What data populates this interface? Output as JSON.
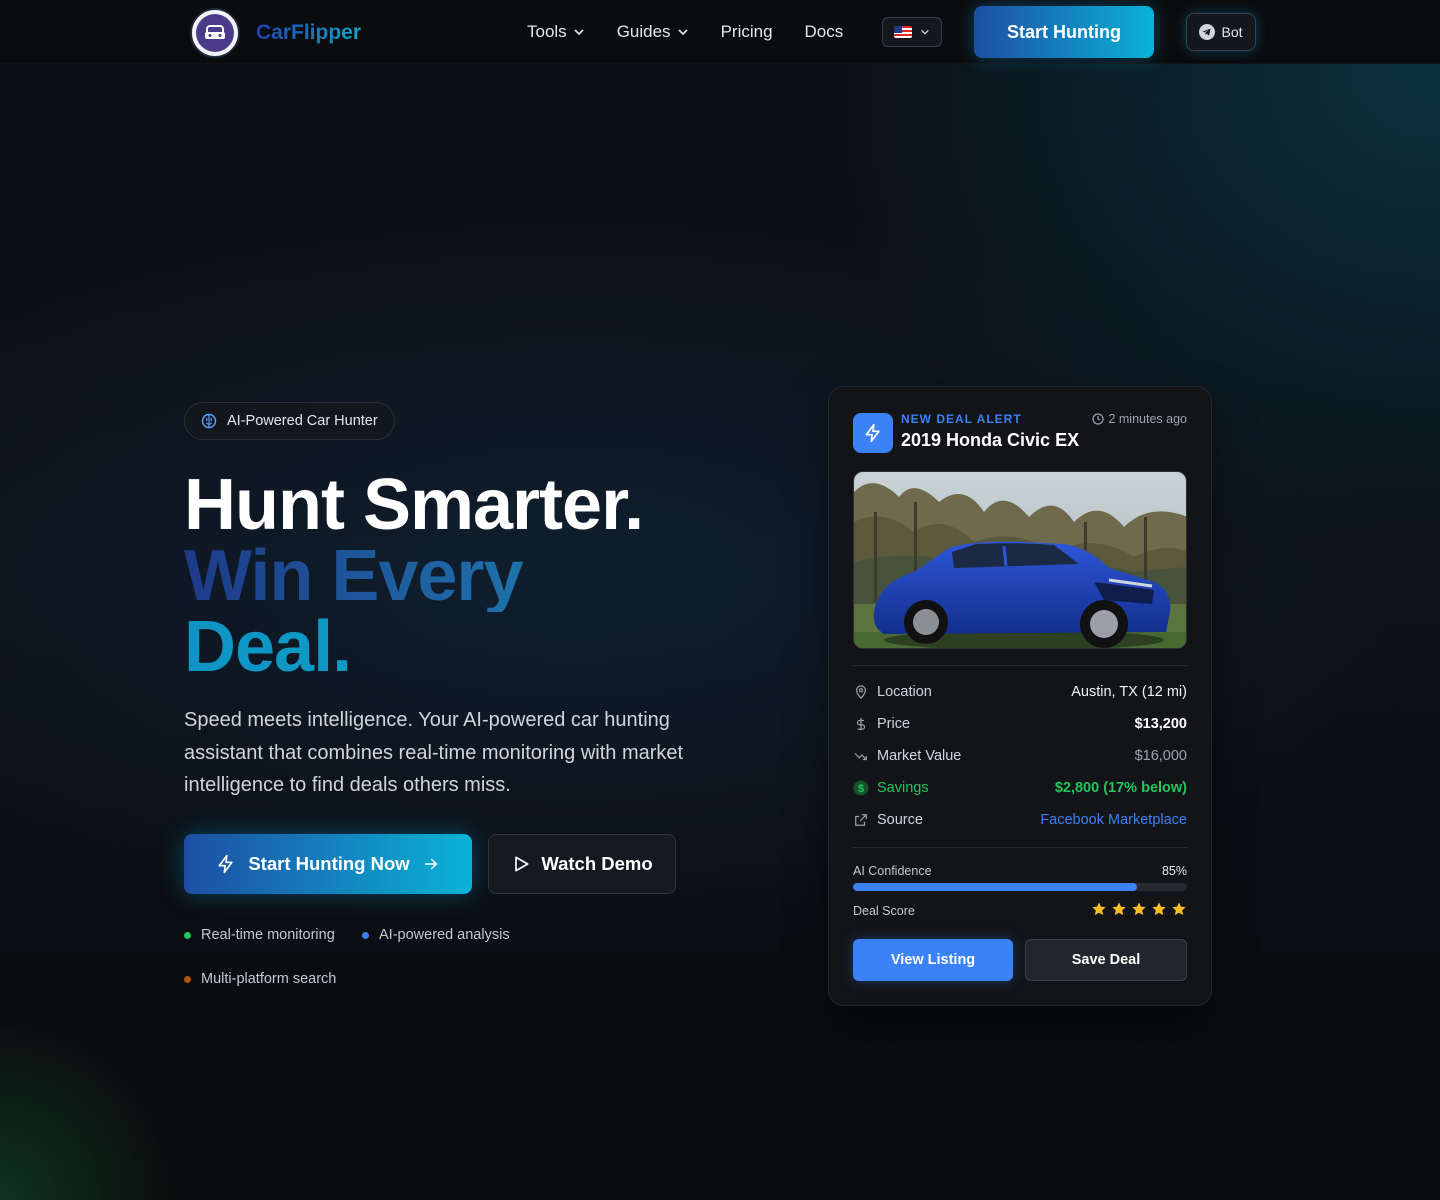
{
  "brand": {
    "name": "CarFlipper"
  },
  "nav": {
    "items": [
      {
        "label": "Tools",
        "has_dropdown": true
      },
      {
        "label": "Guides",
        "has_dropdown": true
      },
      {
        "label": "Pricing",
        "has_dropdown": false
      },
      {
        "label": "Docs",
        "has_dropdown": false
      }
    ],
    "language_flag": "us-flag-icon",
    "start_label": "Start Hunting",
    "bot_label": "Bot"
  },
  "hero": {
    "badge": "AI-Powered Car Hunter",
    "headline_line1": "Hunt Smarter.",
    "headline_line2": "Win Every",
    "headline_line3": "Deal.",
    "subtitle": "Speed meets intelligence. Your AI-powered car hunting assistant that combines real-time monitoring with market intelligence to find deals others miss.",
    "cta_primary": "Start Hunting Now",
    "cta_secondary": "Watch Demo",
    "features": [
      {
        "label": "Real-time monitoring",
        "color": "#22c55e"
      },
      {
        "label": "AI-powered analysis",
        "color": "#3b82f6"
      },
      {
        "label": "Multi-platform search",
        "color": "#b45309"
      }
    ]
  },
  "deal_card": {
    "alert_label": "NEW DEAL ALERT",
    "time_ago": "2 minutes ago",
    "title": "2019 Honda Civic EX",
    "rows": [
      {
        "icon": "map-pin-icon",
        "label": "Location",
        "value": "Austin, TX (12 mi)"
      },
      {
        "icon": "dollar-icon",
        "label": "Price",
        "value": "$13,200"
      },
      {
        "icon": "trending-down-icon",
        "label": "Market Value",
        "value": "$16,000"
      },
      {
        "icon": "savings-icon",
        "label": "Savings",
        "value": "$2,800 (17% below)"
      },
      {
        "icon": "external-link-icon",
        "label": "Source",
        "value": "Facebook Marketplace"
      }
    ],
    "confidence_label": "AI Confidence",
    "confidence_value": "85%",
    "confidence_fraction": 0.85,
    "score_label": "Deal Score",
    "score_stars": 5,
    "view_button": "View Listing",
    "save_button": "Save Deal"
  },
  "colors": {
    "accent_blue": "#3b82f6",
    "savings_green": "#22c55e",
    "link_blue": "#3b82f6",
    "star": "#fbbf24"
  }
}
